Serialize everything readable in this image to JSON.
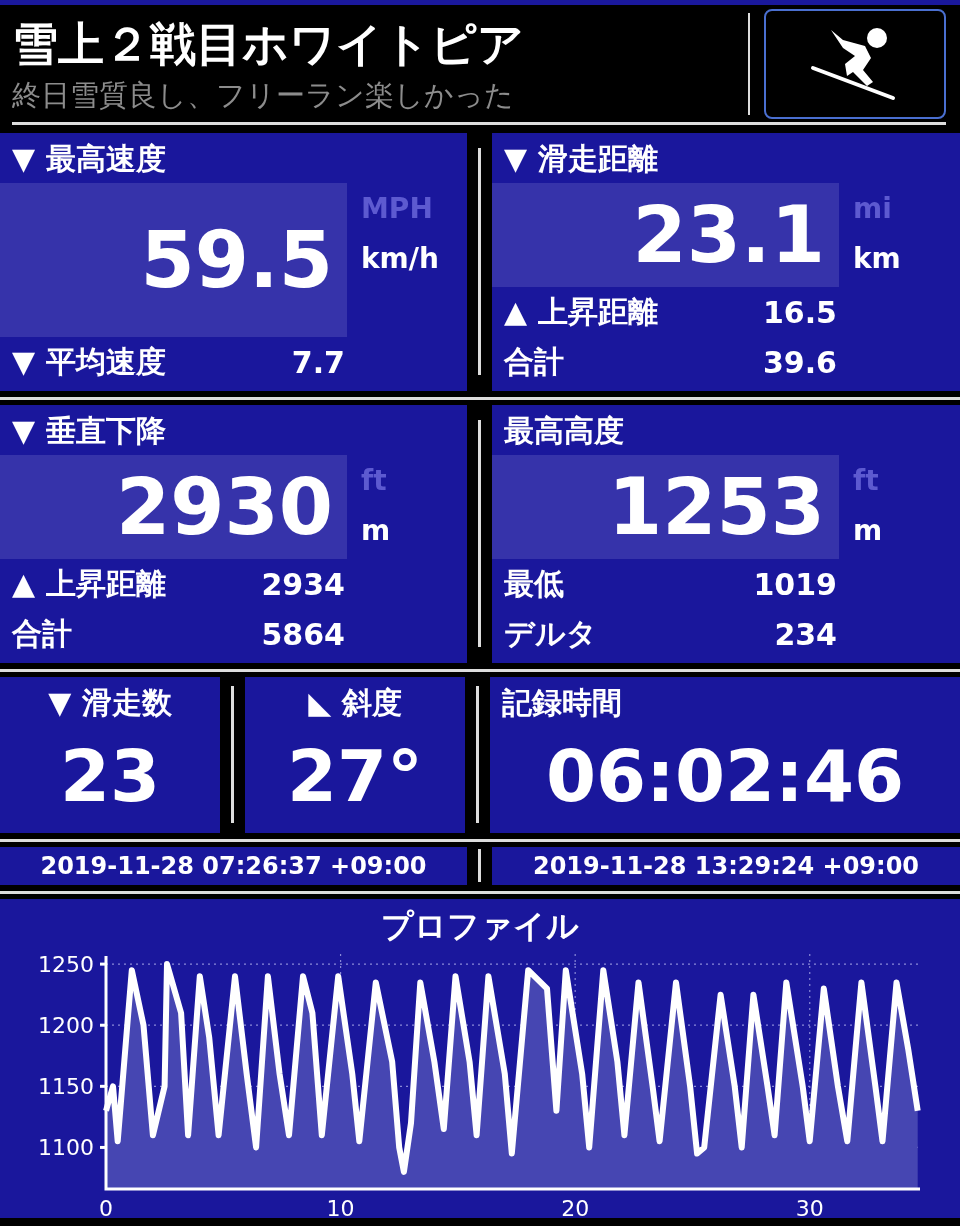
{
  "header": {
    "title": "雪上２戦目ホワイトピア",
    "subtitle": "終日雪質良し、フリーラン楽しかった"
  },
  "metric_panels": [
    {
      "label": "▼ 最高速度",
      "value": "59.5",
      "units": [
        {
          "label": "MPH",
          "selected": false
        },
        {
          "label": "km/h",
          "selected": true
        }
      ],
      "details": [
        {
          "label": "▼ 平均速度",
          "value": "7.7"
        }
      ]
    },
    {
      "label": "▼ 滑走距離",
      "value": "23.1",
      "units": [
        {
          "label": "mi",
          "selected": false
        },
        {
          "label": "km",
          "selected": true
        }
      ],
      "details": [
        {
          "label": "▲ 上昇距離",
          "value": "16.5"
        },
        {
          "label": "合計",
          "value": "39.6"
        }
      ]
    },
    {
      "label": "▼ 垂直下降",
      "value": "2930",
      "units": [
        {
          "label": "ft",
          "selected": false
        },
        {
          "label": "m",
          "selected": true
        }
      ],
      "details": [
        {
          "label": "▲ 上昇距離",
          "value": "2934"
        },
        {
          "label": "合計",
          "value": "5864"
        }
      ]
    },
    {
      "label": "最高高度",
      "value": "1253",
      "units": [
        {
          "label": "ft",
          "selected": false
        },
        {
          "label": "m",
          "selected": true
        }
      ],
      "details": [
        {
          "label": "最低",
          "value": "1019"
        },
        {
          "label": "デルタ",
          "value": "234"
        }
      ]
    }
  ],
  "counters": [
    {
      "label": "▼ 滑走数",
      "value": "23"
    },
    {
      "label": "◣ 斜度",
      "value": "27°"
    }
  ],
  "duration": {
    "label": "記録時間",
    "value": "06:02:46"
  },
  "times": [
    "2019-11-28 07:26:37 +09:00",
    "2019-11-28 13:29:24 +09:00"
  ],
  "profile": {
    "chart_data": {
      "type": "area",
      "title": "プロファイル",
      "xlim": [
        0,
        34.7
      ],
      "ylim": [
        1066,
        1255
      ],
      "xticks": [
        0,
        10,
        20,
        30
      ],
      "yticks": [
        1100,
        1150,
        1200,
        1250
      ],
      "x": [
        0,
        0.3,
        0.5,
        1.1,
        1.6,
        2.0,
        2.5,
        2.6,
        3.2,
        3.5,
        4.0,
        4.4,
        4.8,
        5.5,
        6.0,
        6.4,
        6.9,
        7.4,
        7.8,
        8.4,
        8.8,
        9.2,
        9.9,
        10.5,
        10.8,
        11.5,
        12.2,
        12.5,
        12.7,
        13.0,
        13.4,
        14.0,
        14.4,
        14.9,
        15.5,
        15.8,
        16.3,
        17.0,
        17.3,
        18.0,
        18.8,
        19.2,
        19.6,
        20.3,
        20.6,
        21.2,
        21.8,
        22.1,
        22.7,
        23.3,
        23.6,
        24.3,
        24.9,
        25.2,
        25.5,
        26.2,
        26.8,
        27.1,
        27.6,
        28.2,
        28.5,
        29.0,
        29.7,
        30.0,
        30.6,
        31.2,
        31.6,
        32.2,
        32.8,
        33.1,
        33.7,
        34.2,
        34.6
      ],
      "grid": true,
      "series": [
        {
          "color": "#ffffff",
          "values": [
            1130,
            1150,
            1105,
            1245,
            1200,
            1110,
            1150,
            1250,
            1210,
            1110,
            1240,
            1190,
            1110,
            1240,
            1160,
            1100,
            1240,
            1160,
            1110,
            1240,
            1210,
            1110,
            1240,
            1160,
            1105,
            1235,
            1170,
            1100,
            1080,
            1120,
            1235,
            1170,
            1115,
            1240,
            1170,
            1110,
            1240,
            1160,
            1095,
            1245,
            1230,
            1130,
            1245,
            1160,
            1100,
            1245,
            1170,
            1110,
            1235,
            1150,
            1105,
            1235,
            1150,
            1095,
            1100,
            1225,
            1150,
            1100,
            1225,
            1150,
            1110,
            1235,
            1150,
            1105,
            1230,
            1150,
            1105,
            1235,
            1150,
            1105,
            1235,
            1180,
            1130
          ]
        }
      ]
    }
  }
}
